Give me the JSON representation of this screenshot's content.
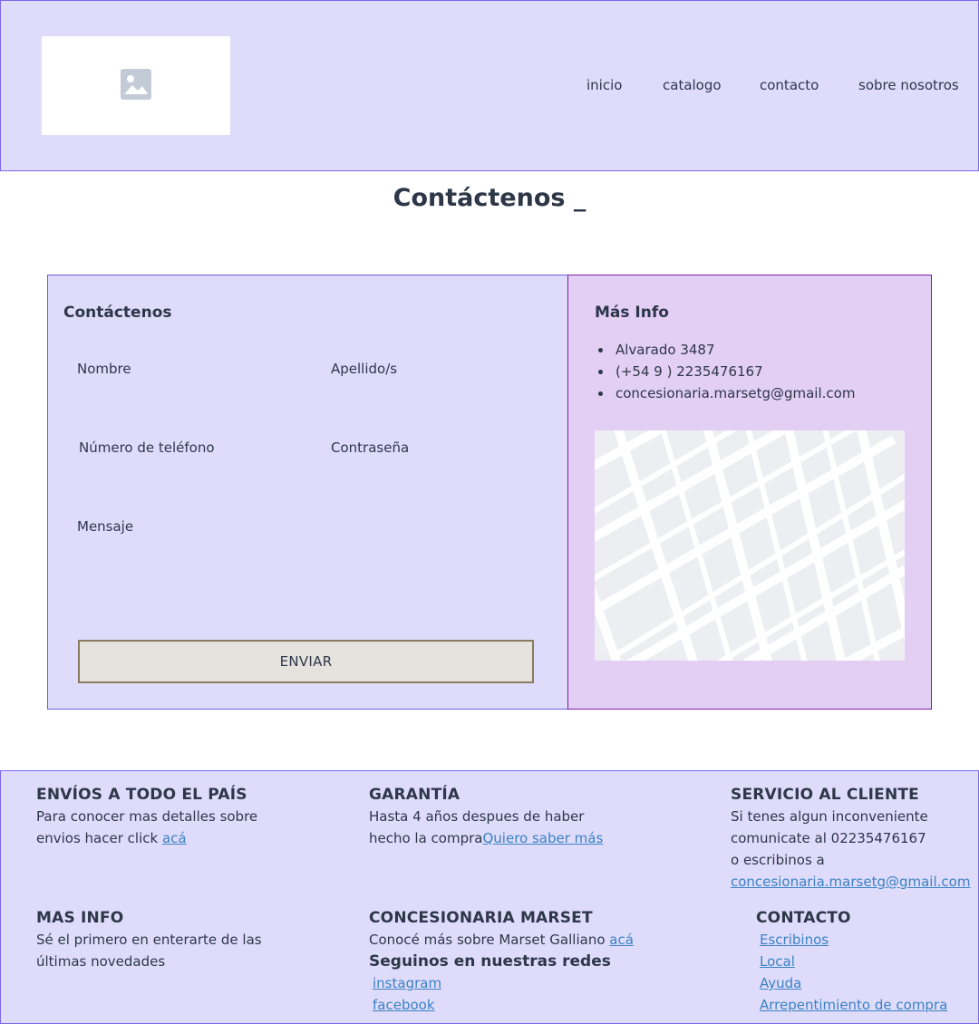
{
  "header": {
    "logo_icon": "image-placeholder-icon",
    "nav": [
      "inicio",
      "catalogo",
      "contacto",
      "sobre nosotros"
    ]
  },
  "page_title": "Contáctenos _",
  "contact_form": {
    "title": "Contáctenos",
    "fields": {
      "nombre": "Nombre",
      "apellido": "Apellido/s",
      "telefono": "Número de teléfono",
      "contrasena": "Contraseña",
      "mensaje": "Mensaje"
    },
    "submit_label": "ENVIAR"
  },
  "info": {
    "title": "Más Info",
    "items": [
      "Alvarado 3487",
      "(+54 9 ) 2235476167",
      "concesionaria.marsetg@gmail.com"
    ],
    "map_icon": "map-placeholder-icon"
  },
  "footer": {
    "envios": {
      "title": "ENVÍOS A TODO EL PAÍS",
      "line1": "Para conocer mas detalles sobre",
      "line2_text": "envios hacer click ",
      "link": "acá"
    },
    "garantia": {
      "title": "GARANTÍA",
      "line1": "Hasta 4 años despues de haber",
      "line2_text": "hecho la compra",
      "link": "Quiero saber más"
    },
    "servicio": {
      "title": "SERVICIO AL CLIENTE",
      "line1": "Si tenes algun inconveniente",
      "line2": "comunicate al 02235476167",
      "line3": "o escribinos a",
      "link": "concesionaria.marsetg@gmail.com"
    },
    "mas_info": {
      "title": "MAS INFO",
      "line1": "Sé el primero en enterarte de las",
      "line2": "últimas novedades"
    },
    "concesionaria": {
      "title": "CONCESIONARIA MARSET",
      "line1_text": "Conocé más sobre Marset Galliano ",
      "link": "acá",
      "social_title": "Seguinos en nuestras redes",
      "social": [
        "instagram",
        "facebook"
      ]
    },
    "contacto": {
      "title": "CONTACTO",
      "links": [
        "Escribinos",
        "Local",
        "Ayuda",
        "Arrepentimiento de compra"
      ]
    }
  },
  "colors": {
    "panel_bg": "#dfdcfb",
    "panel_border": "#7b68ee",
    "info_bg": "#e3cef4",
    "info_border": "#7a1fa2",
    "link": "#3b82c4",
    "text": "#2d3748"
  }
}
